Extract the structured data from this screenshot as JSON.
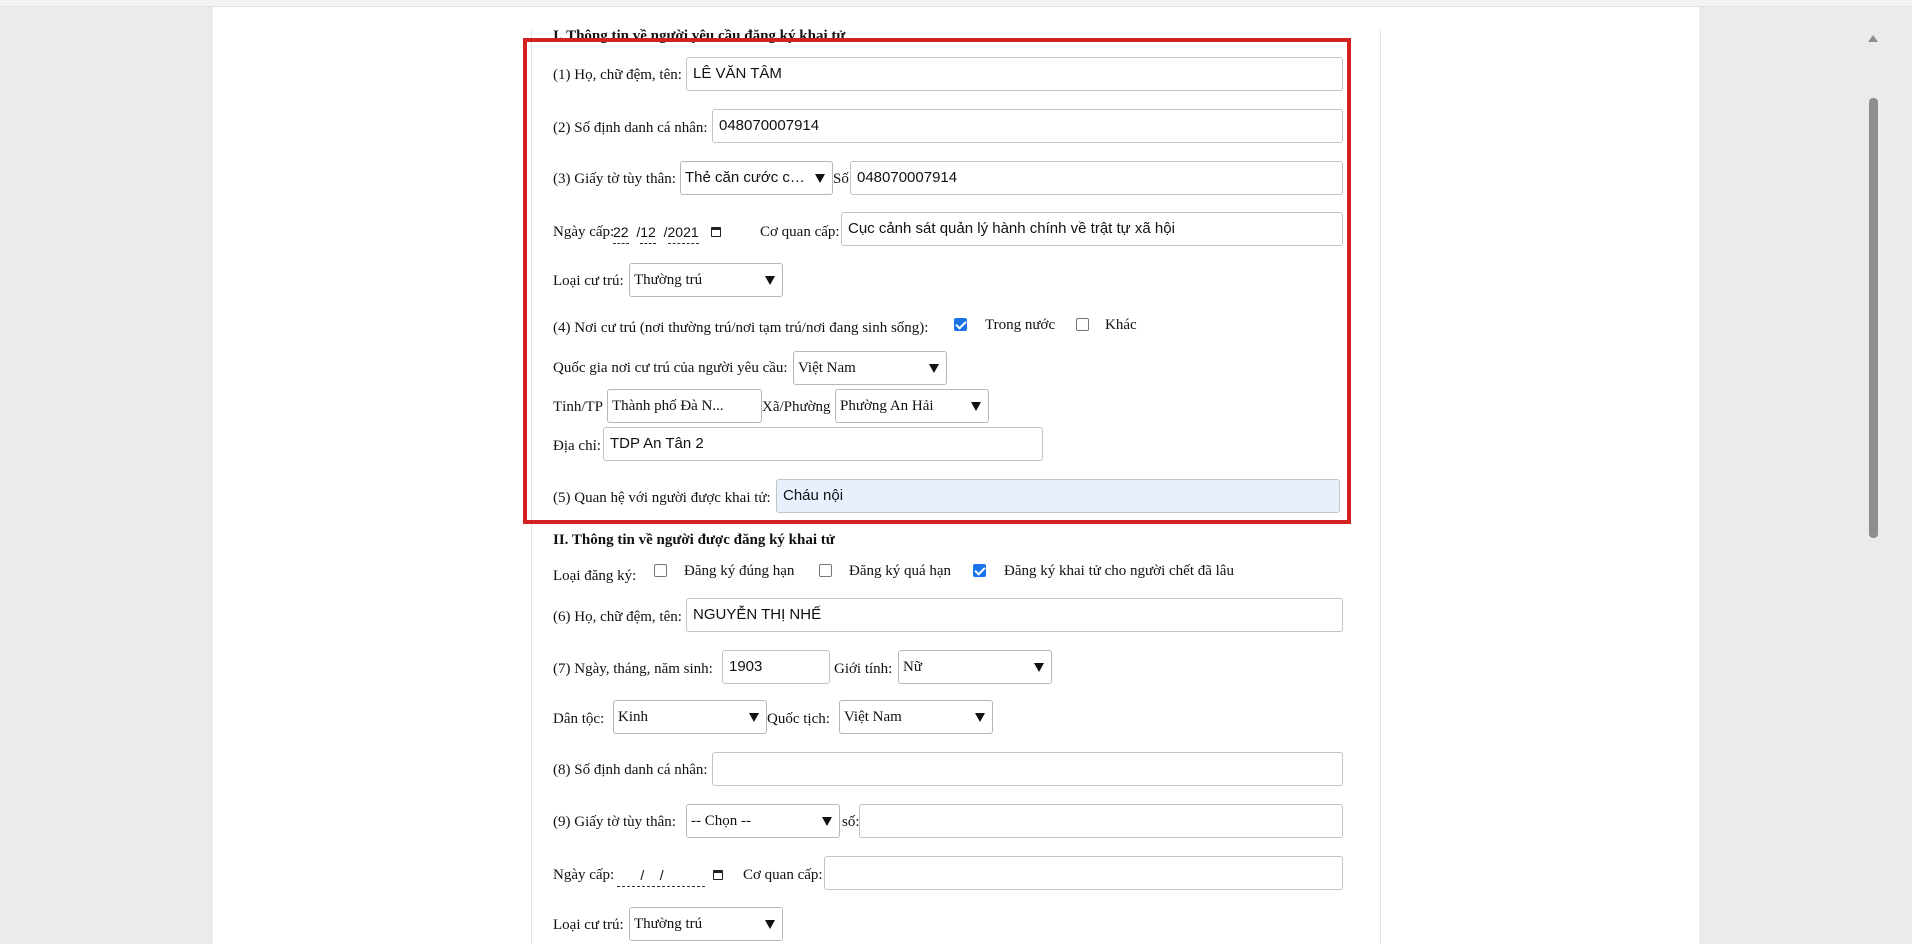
{
  "section1": {
    "title": "I. Thông tin về người yêu cầu đăng ký khai tử",
    "fullname_label": "(1) Họ, chữ đệm, tên:",
    "fullname_value": "LÊ VĂN TÂM",
    "id_label": "(2) Số định danh cá nhân:",
    "id_value": "048070007914",
    "doc_label": "(3) Giấy tờ tùy thân:",
    "doc_type": "Thẻ căn cước cô...",
    "doc_no_label": "Số",
    "doc_no_value": "048070007914",
    "issue_date_label": "Ngày cấp:",
    "issue_date": {
      "day": "22",
      "month": "12",
      "year": "2021"
    },
    "issuer_label": "Cơ quan cấp:",
    "issuer_value": "Cục cảnh sát quản lý hành chính về trật tự xã hội",
    "residence_type_label": "Loại cư trú:",
    "residence_type": "Thường trú",
    "residence_label": "(4) Nơi cư trú (nơi thường trú/nơi tạm trú/nơi đang sinh sống):",
    "domestic_label": "Trong nước",
    "domestic_checked": true,
    "other_label": "Khác",
    "other_checked": false,
    "country_label": "Quốc gia nơi cư trú của người yêu cầu:",
    "country_value": "Việt Nam",
    "province_label": "Tỉnh/TP",
    "province_value": "Thành phố Đà N...",
    "ward_label": "Xã/Phường",
    "ward_value": "Phường An Hải",
    "address_label": "Địa chỉ:",
    "address_value": "TDP An Tân 2",
    "relation_label": "(5) Quan hệ với người được khai tử:",
    "relation_value": "Cháu nội"
  },
  "section2": {
    "title": "II. Thông tin về người được đăng ký khai tử",
    "reg_type_label": "Loại đăng ký:",
    "reg_options": [
      {
        "label": "Đăng ký đúng hạn",
        "checked": false
      },
      {
        "label": "Đăng ký quá hạn",
        "checked": false
      },
      {
        "label": "Đăng ký khai tử cho người chết đã lâu",
        "checked": true
      }
    ],
    "fullname_label": "(6) Họ, chữ đệm, tên:",
    "fullname_value": "NGUYỄN THỊ NHẾ",
    "dob_label": "(7) Ngày, tháng, năm sinh:",
    "dob_value": "1903",
    "gender_label": "Giới tính:",
    "gender_value": "Nữ",
    "ethnic_label": "Dân tộc:",
    "ethnic_value": "Kinh",
    "nationality_label": "Quốc tịch:",
    "nationality_value": "Việt Nam",
    "id_label": "(8) Số định danh cá nhân:",
    "id_value": "",
    "doc_label": "(9) Giấy tờ tùy thân:",
    "doc_type": "-- Chọn --",
    "doc_no_label": "số:",
    "doc_no_value": "",
    "issue_date_label": "Ngày cấp:",
    "issue_date_blank": "/",
    "issuer_label": "Cơ quan cấp:",
    "issuer_value": "",
    "residence_type_label": "Loại cư trú:",
    "residence_type": "Thường trú"
  },
  "colors": {
    "highlight_border": "#d32020",
    "checkbox_checked": "#1a73e8",
    "autofill_bg": "#e8f0fe"
  }
}
